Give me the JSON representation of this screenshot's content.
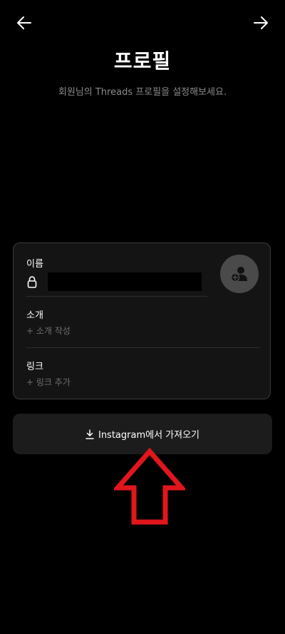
{
  "header": {
    "back_icon": "arrow-left-icon",
    "next_icon": "arrow-right-icon",
    "title": "프로필",
    "subtitle": "회원님의 Threads 프로필을 설정해보세요."
  },
  "card": {
    "name_label": "이름",
    "name_value": "",
    "lock_icon": "lock-icon",
    "avatar_icon": "add-person-icon",
    "intro_label": "소개",
    "intro_placeholder": "+ 소개 작성",
    "link_label": "링크",
    "link_placeholder": "+ 링크 추가"
  },
  "import_button": {
    "icon": "download-icon",
    "label": "Instagram에서 가져오기"
  },
  "annotation": {
    "arrow_color": "#e0161c"
  },
  "colors": {
    "background": "#000000",
    "card": "#141414",
    "button": "#1c1c1c",
    "muted_text": "#8a8a8a"
  }
}
